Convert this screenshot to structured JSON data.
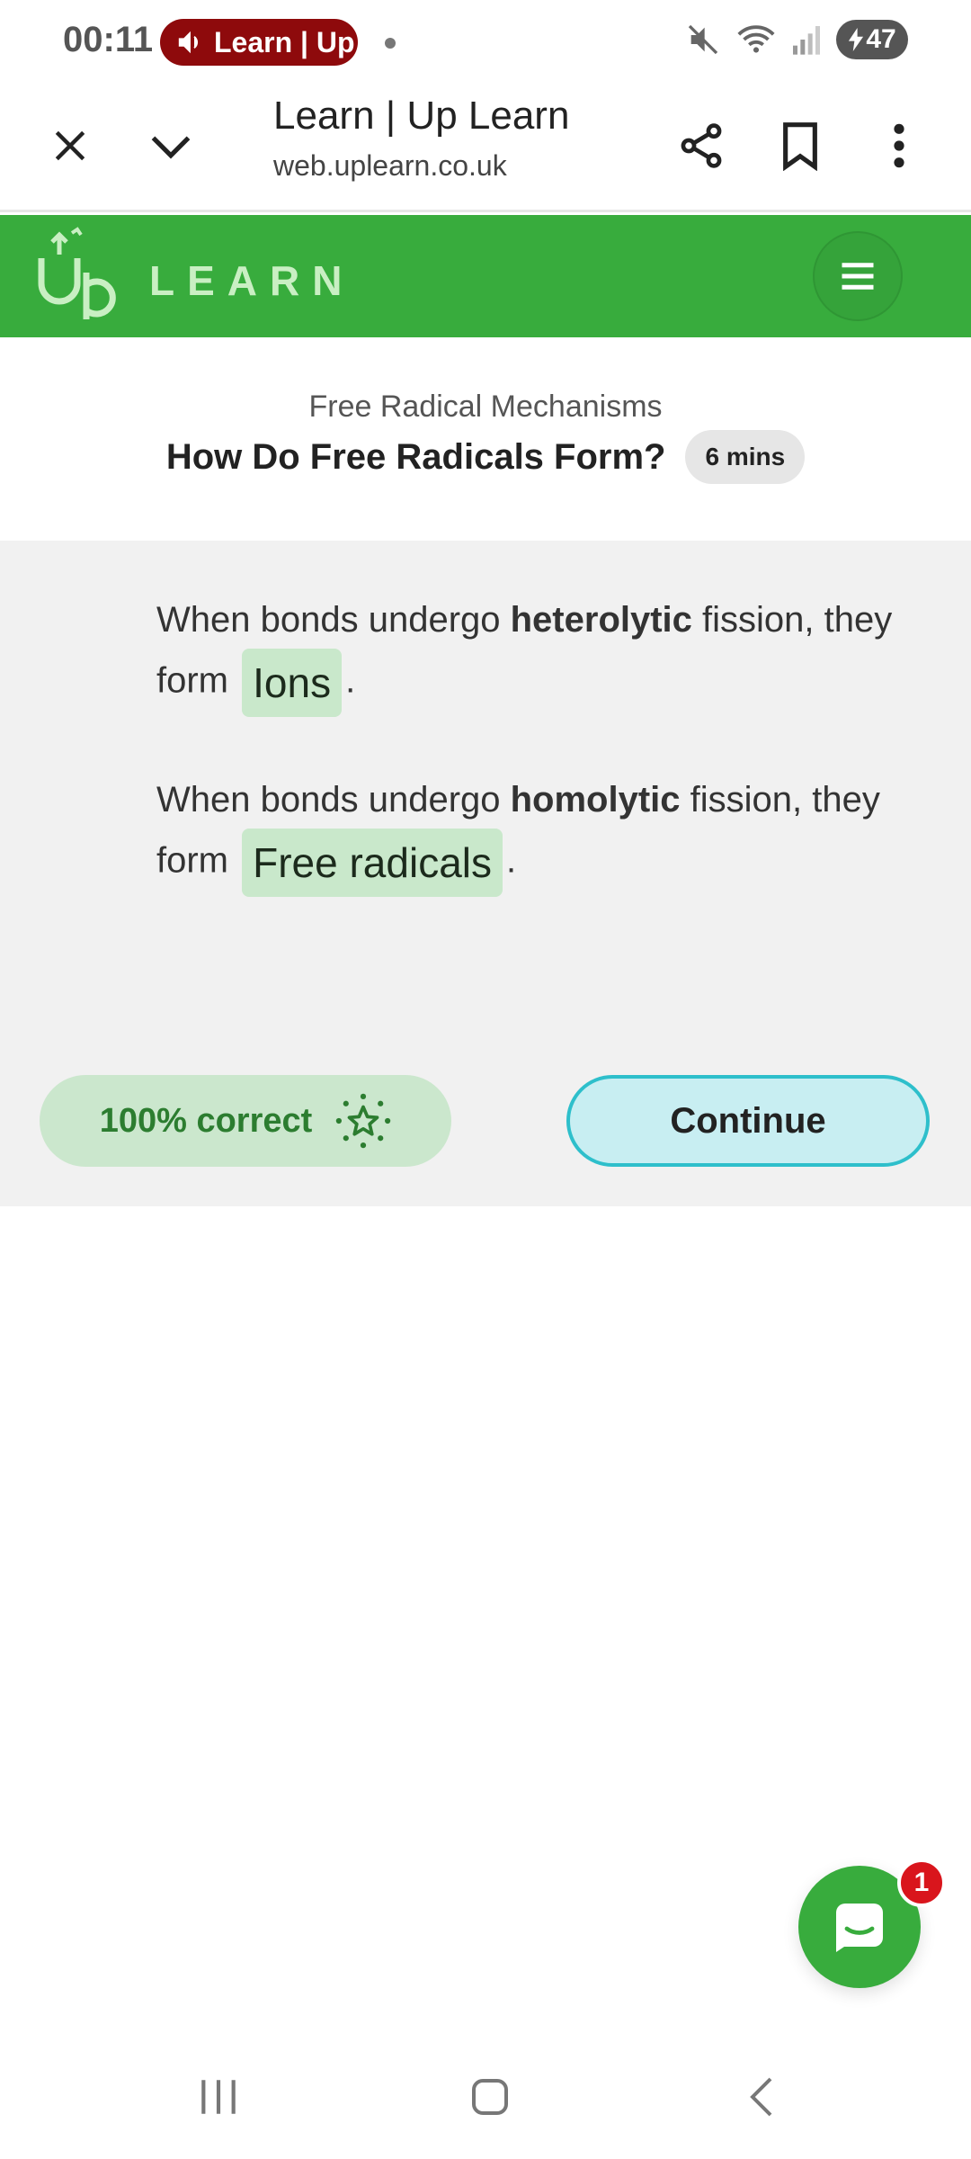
{
  "status_bar": {
    "time": "00:11",
    "media_label": "Learn | Up",
    "battery": "47"
  },
  "browser": {
    "title": "Learn | Up Learn",
    "url": "web.uplearn.co.uk"
  },
  "site": {
    "brand_word": "LEARN",
    "brand_color": "#38ac3d"
  },
  "lesson": {
    "topic": "Free Radical Mechanisms",
    "title": "How Do Free Radicals Form?",
    "duration": "6 mins"
  },
  "questions": [
    {
      "prefix": "When bonds undergo ",
      "bold": "heterolytic",
      "middle": " fission, they form ",
      "answer": "Ions",
      "suffix": "."
    },
    {
      "prefix": "When bonds undergo ",
      "bold": "homolytic",
      "middle": " fission, they form ",
      "answer": "Free radicals",
      "suffix": "."
    }
  ],
  "result": {
    "score_label": "100% correct",
    "continue_label": "Continue"
  },
  "chat": {
    "badge_count": "1"
  }
}
